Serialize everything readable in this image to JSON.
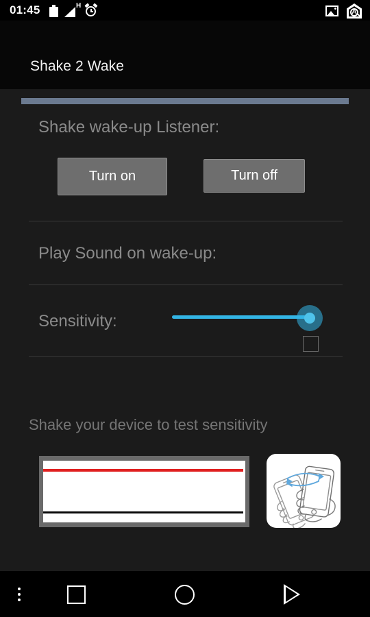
{
  "status_bar": {
    "clock": "01:45",
    "icons": {
      "battery": "battery-icon",
      "signal": "signal-triangle-icon",
      "network_type": "H",
      "alarm": "alarm-clock-icon",
      "screenshot": "image-icon",
      "app": "app-shortcut-icon"
    }
  },
  "header": {
    "title": "Shake 2 Wake",
    "underline_color": "#6b7a90"
  },
  "listener_section": {
    "label": "Shake wake-up Listener:",
    "turn_on_label": "Turn on",
    "turn_off_label": "Turn off"
  },
  "play_sound_section": {
    "label": "Play Sound on wake-up:",
    "checked": false
  },
  "sensitivity_section": {
    "label": "Sensitivity:",
    "value": 100,
    "min": 0,
    "max": 100,
    "accent_color": "#33b5e5"
  },
  "test_section": {
    "hint": "Shake your device to test sensitivity",
    "graph": {
      "threshold_line_color": "#e02020",
      "trace_line_color": "#0a0a0a",
      "background": "#ffffff",
      "frame_color": "#6a6a6a"
    },
    "illustration": "shake-phone-icon"
  },
  "nav_bar": {
    "menu": "overflow-menu-icon",
    "recents": "square-recents-icon",
    "home": "circle-home-icon",
    "back": "triangle-back-icon"
  }
}
